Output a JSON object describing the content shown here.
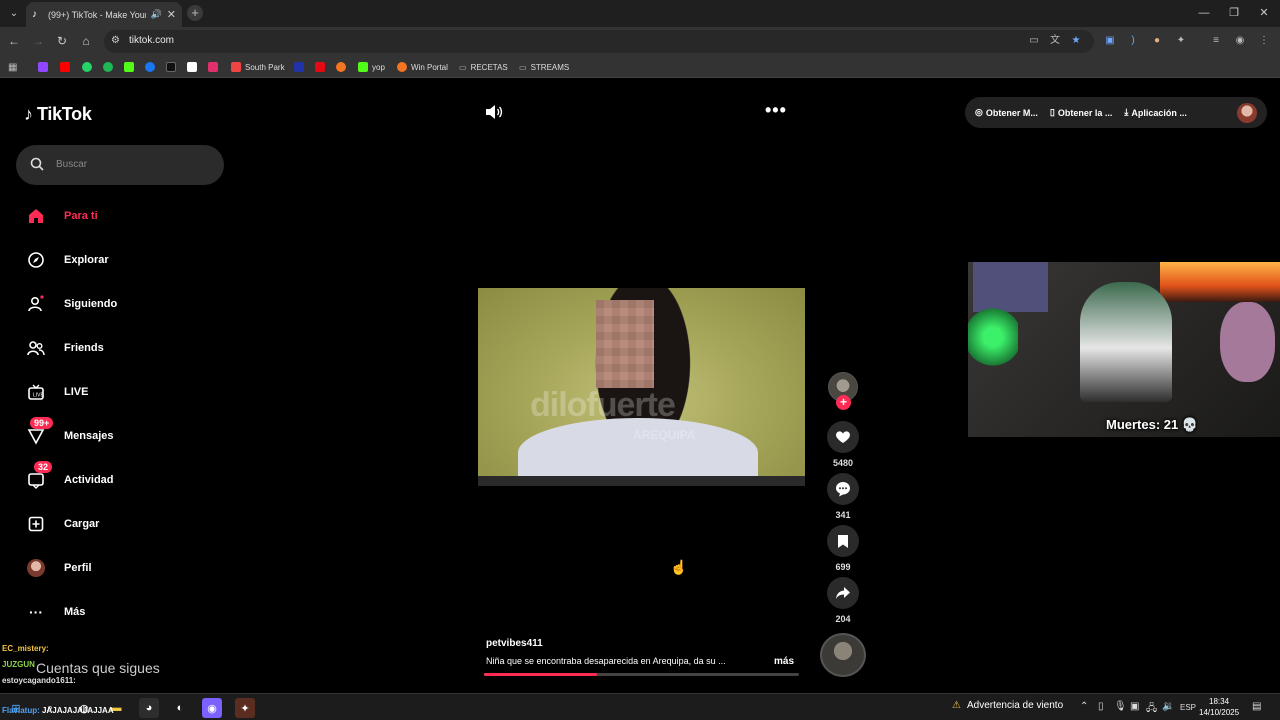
{
  "browser": {
    "tab_title": "(99+) TikTok - Make Your D...",
    "url": "tiktok.com",
    "bookmarks": [
      "South Park",
      "yop",
      "Win Portal",
      "RECETAS",
      "STREAMS"
    ]
  },
  "tiktok": {
    "logo_text": "TikTok",
    "search_placeholder": "Buscar",
    "nav": [
      {
        "label": "Para ti"
      },
      {
        "label": "Explorar"
      },
      {
        "label": "Siguiendo"
      },
      {
        "label": "Friends"
      },
      {
        "label": "LIVE"
      },
      {
        "label": "Mensajes",
        "badge": "99+"
      },
      {
        "label": "Actividad",
        "badge": "32"
      },
      {
        "label": "Cargar"
      },
      {
        "label": "Perfil"
      },
      {
        "label": "Más"
      }
    ],
    "top_buttons": [
      "Obtener M...",
      "Obtener la ...",
      "Aplicación ..."
    ],
    "video": {
      "watermark": "dilofuerte",
      "watermark_sub": "AREQUIPA",
      "author": "petvibes411",
      "description": "Niña que se encontraba desaparecida en Arequipa, da su ...",
      "more_label": "más",
      "progress": 0.36,
      "likes": "5480",
      "comments": "341",
      "saves": "699",
      "shares": "204"
    }
  },
  "stream_overlay": {
    "deaths_label": "Muertes: 21 💀",
    "following_label": "Cuentas que sigues",
    "chat": [
      {
        "user": "EC_mistery:",
        "text": "",
        "color": "#f5c542"
      },
      {
        "user": "JUZGUN",
        "text": "",
        "color": "#8fd14f"
      },
      {
        "user": "estoycagando1611:",
        "text": "",
        "color": "#e0e0e0"
      },
      {
        "user": "Flaviatup:",
        "text": "JAJAJAJAJAJJAA",
        "color": "#4fa3f7"
      }
    ]
  },
  "taskbar": {
    "weather_text": "Advertencia de viento",
    "language": "ESP",
    "time": "18:34",
    "date": "14/10/2025"
  },
  "colors": {
    "accent": "#fe2c55",
    "background": "#000000",
    "chrome": "#333333"
  }
}
